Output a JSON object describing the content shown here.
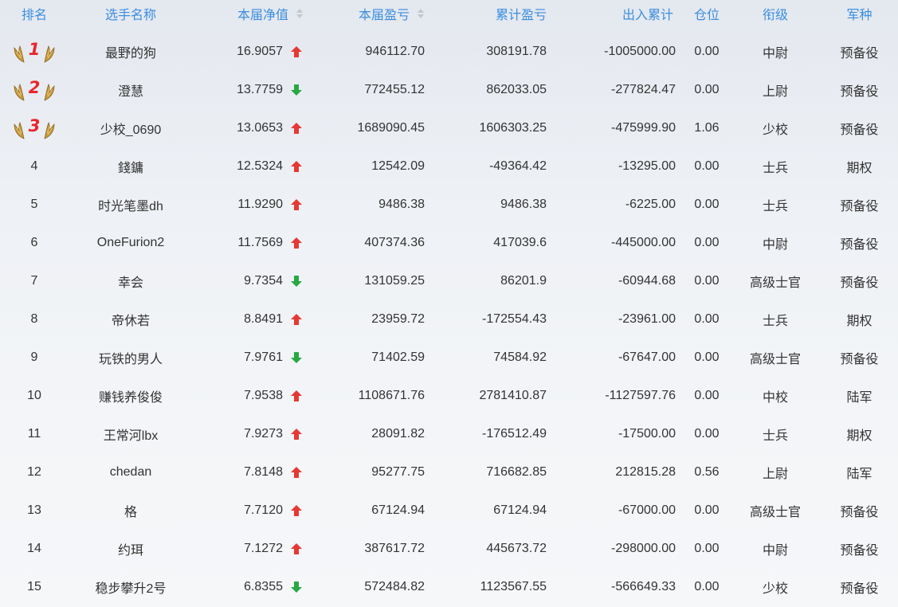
{
  "header": {
    "rank": "排名",
    "name": "选手名称",
    "nav": "本届净值",
    "profit": "本届盈亏",
    "cumulative": "累计盈亏",
    "flow": "出入累计",
    "position": "仓位",
    "military_rank": "衔级",
    "branch": "军种"
  },
  "colors": {
    "header_text": "#3b8ee0",
    "arrow_up": "#e53935",
    "arrow_down": "#27a844",
    "medal_number": "#e8262b"
  },
  "rows": [
    {
      "rank": "1",
      "name": "最野的狗",
      "nav": "16.9057",
      "trend": "up",
      "profit": "946112.70",
      "cumulative": "308191.78",
      "flow": "-1005000.00",
      "position": "0.00",
      "military_rank": "中尉",
      "branch": "预备役"
    },
    {
      "rank": "2",
      "name": "澄慧",
      "nav": "13.7759",
      "trend": "down",
      "profit": "772455.12",
      "cumulative": "862033.05",
      "flow": "-277824.47",
      "position": "0.00",
      "military_rank": "上尉",
      "branch": "预备役"
    },
    {
      "rank": "3",
      "name": "少校_0690",
      "nav": "13.0653",
      "trend": "up",
      "profit": "1689090.45",
      "cumulative": "1606303.25",
      "flow": "-475999.90",
      "position": "1.06",
      "military_rank": "少校",
      "branch": "预备役"
    },
    {
      "rank": "4",
      "name": "錢鏞",
      "nav": "12.5324",
      "trend": "up",
      "profit": "12542.09",
      "cumulative": "-49364.42",
      "flow": "-13295.00",
      "position": "0.00",
      "military_rank": "士兵",
      "branch": "期权"
    },
    {
      "rank": "5",
      "name": "时光笔墨dh",
      "nav": "11.9290",
      "trend": "up",
      "profit": "9486.38",
      "cumulative": "9486.38",
      "flow": "-6225.00",
      "position": "0.00",
      "military_rank": "士兵",
      "branch": "预备役"
    },
    {
      "rank": "6",
      "name": "OneFurion2",
      "nav": "11.7569",
      "trend": "up",
      "profit": "407374.36",
      "cumulative": "417039.6",
      "flow": "-445000.00",
      "position": "0.00",
      "military_rank": "中尉",
      "branch": "预备役"
    },
    {
      "rank": "7",
      "name": "幸会",
      "nav": "9.7354",
      "trend": "down",
      "profit": "131059.25",
      "cumulative": "86201.9",
      "flow": "-60944.68",
      "position": "0.00",
      "military_rank": "高级士官",
      "branch": "预备役"
    },
    {
      "rank": "8",
      "name": "帝休若",
      "nav": "8.8491",
      "trend": "up",
      "profit": "23959.72",
      "cumulative": "-172554.43",
      "flow": "-23961.00",
      "position": "0.00",
      "military_rank": "士兵",
      "branch": "期权"
    },
    {
      "rank": "9",
      "name": "玩铁的男人",
      "nav": "7.9761",
      "trend": "down",
      "profit": "71402.59",
      "cumulative": "74584.92",
      "flow": "-67647.00",
      "position": "0.00",
      "military_rank": "高级士官",
      "branch": "预备役"
    },
    {
      "rank": "10",
      "name": "赚钱养俊俊",
      "nav": "7.9538",
      "trend": "up",
      "profit": "1108671.76",
      "cumulative": "2781410.87",
      "flow": "-1127597.76",
      "position": "0.00",
      "military_rank": "中校",
      "branch": "陆军"
    },
    {
      "rank": "11",
      "name": "王常河lbx",
      "nav": "7.9273",
      "trend": "up",
      "profit": "28091.82",
      "cumulative": "-176512.49",
      "flow": "-17500.00",
      "position": "0.00",
      "military_rank": "士兵",
      "branch": "期权"
    },
    {
      "rank": "12",
      "name": "chedan",
      "nav": "7.8148",
      "trend": "up",
      "profit": "95277.75",
      "cumulative": "716682.85",
      "flow": "212815.28",
      "position": "0.56",
      "military_rank": "上尉",
      "branch": "陆军"
    },
    {
      "rank": "13",
      "name": "格",
      "nav": "7.7120",
      "trend": "up",
      "profit": "67124.94",
      "cumulative": "67124.94",
      "flow": "-67000.00",
      "position": "0.00",
      "military_rank": "高级士官",
      "branch": "预备役"
    },
    {
      "rank": "14",
      "name": "约珥",
      "nav": "7.1272",
      "trend": "up",
      "profit": "387617.72",
      "cumulative": "445673.72",
      "flow": "-298000.00",
      "position": "0.00",
      "military_rank": "中尉",
      "branch": "预备役"
    },
    {
      "rank": "15",
      "name": "稳步攀升2号",
      "nav": "6.8355",
      "trend": "down",
      "profit": "572484.82",
      "cumulative": "1123567.55",
      "flow": "-566649.33",
      "position": "0.00",
      "military_rank": "少校",
      "branch": "预备役"
    }
  ]
}
